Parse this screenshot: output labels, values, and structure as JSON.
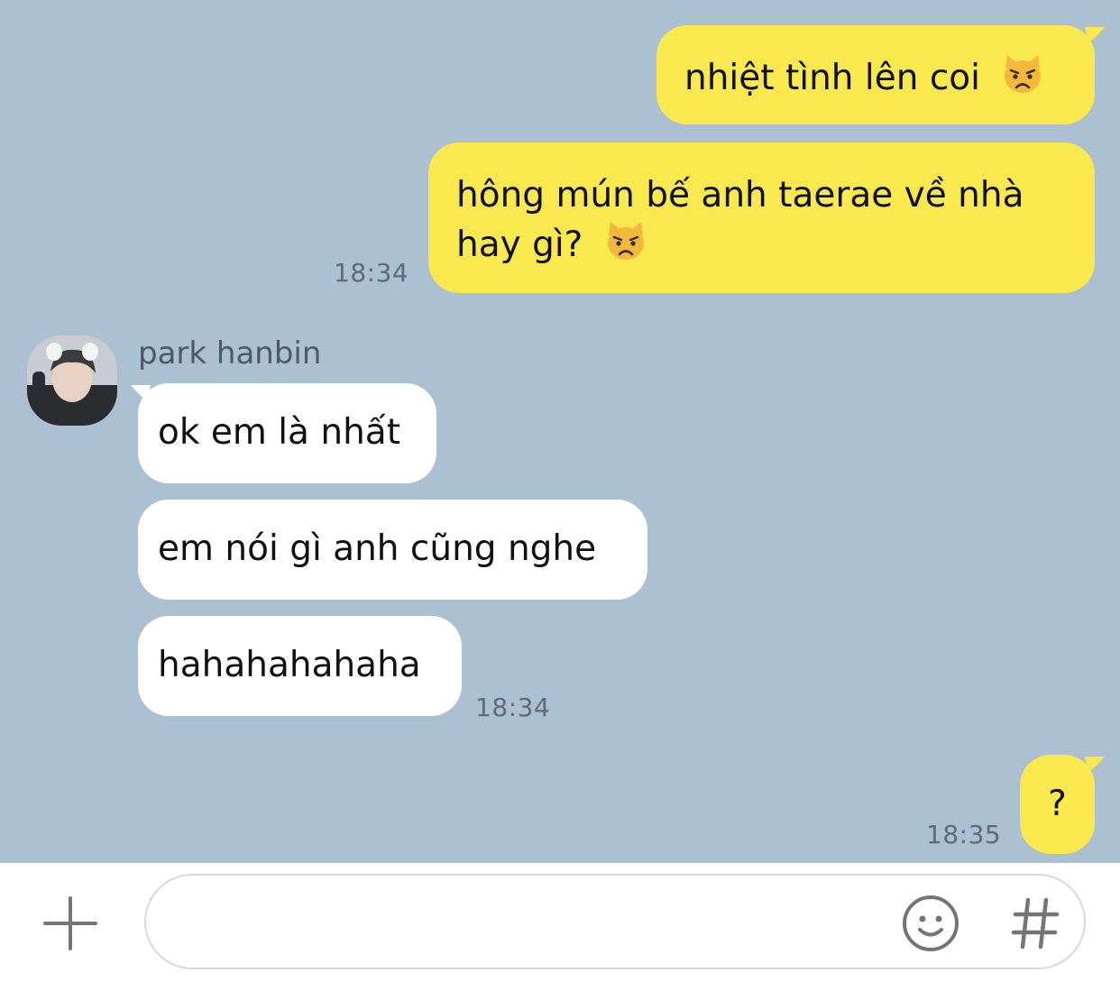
{
  "conversation": {
    "outgoing_block_1": {
      "messages": [
        {
          "text": "nhiệt tình lên coi",
          "emoji": "pouting-cat-face"
        },
        {
          "line1": "hông mún bế anh taerae về nhà",
          "line2": "hay gì?",
          "emoji": "pouting-cat-face"
        }
      ],
      "time": "18:34"
    },
    "incoming_block": {
      "sender_name": "park hanbin",
      "messages": [
        {
          "text": "ok em là nhất"
        },
        {
          "text": "em nói gì anh cũng nghe"
        },
        {
          "text": "hahahahahaha"
        }
      ],
      "time": "18:34"
    },
    "outgoing_block_2": {
      "messages": [
        {
          "text": "?"
        }
      ],
      "time": "18:35"
    }
  },
  "composer": {
    "placeholder": "",
    "plus_icon": "plus-icon",
    "emoji_icon": "smiley-icon",
    "hash_icon": "hashtag-icon"
  },
  "colors": {
    "chat_background": "#abc0d1",
    "outgoing_bubble": "#fae84f",
    "incoming_bubble": "#ffffff",
    "timestamp": "#5f6b77",
    "sender_name": "#4c5966"
  }
}
